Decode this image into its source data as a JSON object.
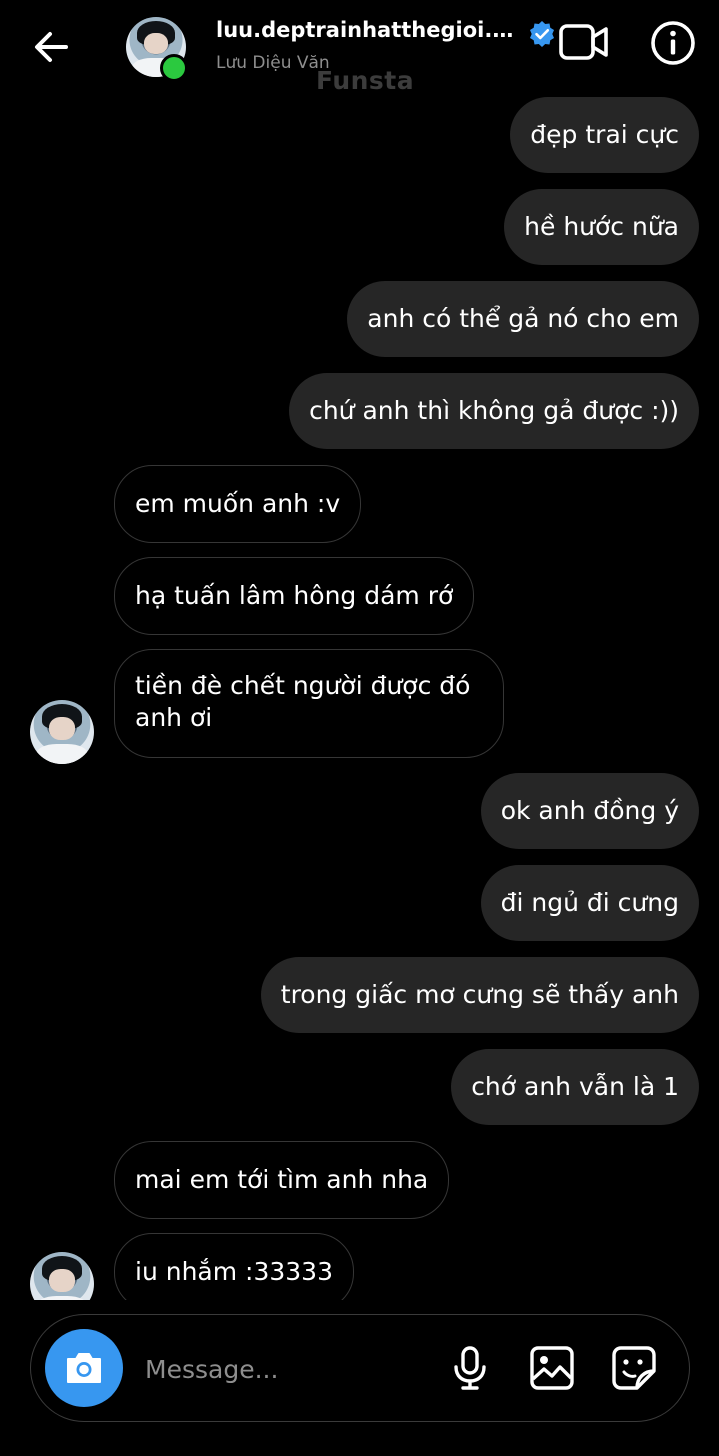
{
  "header": {
    "username": "luu.deptrainhatthegioi.dieu...",
    "display_name": "Lưu Diệu Văn",
    "watermark": "Funsta"
  },
  "messages": [
    {
      "side": "out",
      "text": "đẹp trai cực"
    },
    {
      "side": "out",
      "text": "hề hước nữa"
    },
    {
      "side": "out",
      "text": "anh có thể gả nó cho em"
    },
    {
      "side": "out",
      "text": "chứ anh thì không gả được :))"
    },
    {
      "side": "in",
      "text": "em muốn anh :v"
    },
    {
      "side": "in",
      "text": "hạ tuấn lâm hông dám rớ"
    },
    {
      "side": "in",
      "text": "tiền đè chết người được đó anh ơi"
    },
    {
      "side": "out",
      "text": "ok anh đồng ý"
    },
    {
      "side": "out",
      "text": "đi ngủ đi cưng"
    },
    {
      "side": "out",
      "text": "trong giấc mơ cưng sẽ thấy anh"
    },
    {
      "side": "out",
      "text": "chớ anh vẫn là 1"
    },
    {
      "side": "in",
      "text": "mai em tới tìm anh nha"
    },
    {
      "side": "in",
      "text": "iu nhắm :33333"
    }
  ],
  "composer": {
    "placeholder": "Message..."
  },
  "colors": {
    "background": "#000000",
    "outgoing_bubble": "#262626",
    "accent": "#3797f0",
    "online": "#2bc93f",
    "verified": "#3797f0"
  },
  "icons": [
    "back-arrow-icon",
    "verified-badge-icon",
    "video-call-icon",
    "info-icon",
    "camera-icon",
    "microphone-icon",
    "gallery-icon",
    "sticker-icon"
  ]
}
